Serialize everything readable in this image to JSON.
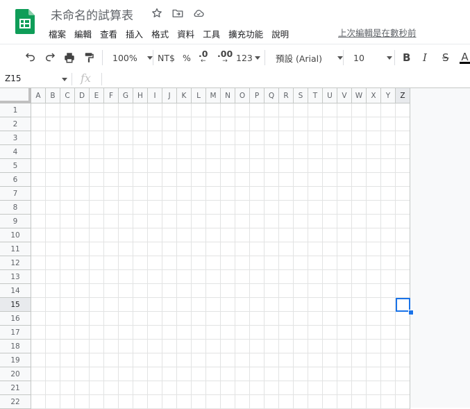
{
  "doc": {
    "title": "未命名的試算表",
    "last_edit": "上次編輯是在數秒前"
  },
  "menus": [
    "檔案",
    "編輯",
    "查看",
    "插入",
    "格式",
    "資料",
    "工具",
    "擴充功能",
    "說明"
  ],
  "toolbar": {
    "zoom": "100%",
    "currency": "NT$",
    "percent": "%",
    "decrease_decimal": ".0",
    "increase_decimal": ".00",
    "more_formats": "123",
    "font": "預設 (Arial)",
    "font_size": "10",
    "bold": "B",
    "italic": "I",
    "strikethrough": "S",
    "text_color": "A"
  },
  "formula_bar": {
    "name_box": "Z15",
    "fx": "fx"
  },
  "grid": {
    "columns": [
      "A",
      "B",
      "C",
      "D",
      "E",
      "F",
      "G",
      "H",
      "I",
      "J",
      "K",
      "L",
      "M",
      "N",
      "O",
      "P",
      "Q",
      "R",
      "S",
      "T",
      "U",
      "V",
      "W",
      "X",
      "Y",
      "Z"
    ],
    "rows": [
      "1",
      "2",
      "3",
      "4",
      "5",
      "6",
      "7",
      "8",
      "9",
      "10",
      "11",
      "12",
      "13",
      "14",
      "15",
      "16",
      "17",
      "18",
      "19",
      "20",
      "21",
      "22"
    ],
    "selected_column": "Z",
    "selected_row": "15"
  },
  "colors": {
    "selection": "#1a73e8",
    "logo_green": "#0f9d58"
  }
}
